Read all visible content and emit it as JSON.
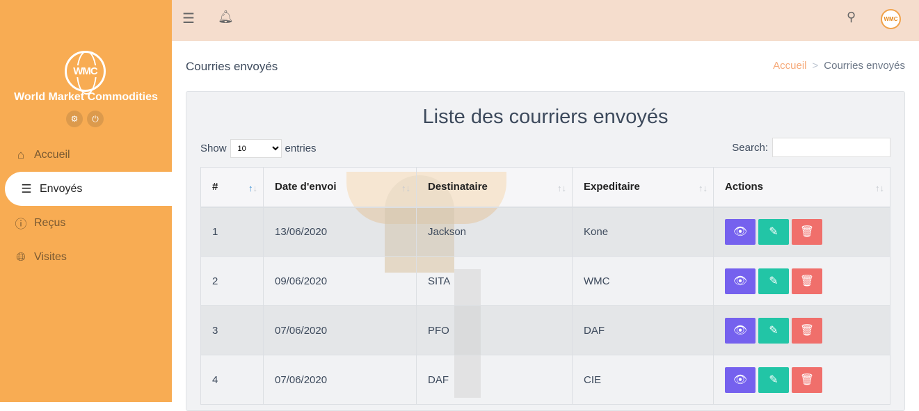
{
  "sidebar": {
    "logo_text": "WMC",
    "brand": "World Market Commodities",
    "items": [
      {
        "label": "Accueil",
        "icon": "home-icon"
      },
      {
        "label": "Envoyés",
        "icon": "list-icon"
      },
      {
        "label": "Reçus",
        "icon": "info-icon"
      },
      {
        "label": "Visites",
        "icon": "globe-icon"
      }
    ]
  },
  "topbar": {
    "avatar_text": "WMC"
  },
  "page": {
    "title": "Courries envoyés",
    "breadcrumb": [
      "Accueil",
      "Courries envoyés"
    ]
  },
  "card": {
    "title": "Liste des courriers envoyés",
    "show_label": "Show",
    "entries_label": "entries",
    "page_size": "10",
    "search_label": "Search:",
    "search_value": ""
  },
  "table": {
    "columns": [
      "#",
      "Date d'envoi",
      "Destinataire",
      "Expeditaire",
      "Actions"
    ],
    "rows": [
      [
        "1",
        "13/06/2020",
        "Jackson",
        "Kone"
      ],
      [
        "2",
        "09/06/2020",
        "SITA",
        "WMC"
      ],
      [
        "3",
        "07/06/2020",
        "PFO",
        "DAF"
      ],
      [
        "4",
        "07/06/2020",
        "DAF",
        "CIE"
      ]
    ]
  },
  "colors": {
    "sidebar": "#f8ac53",
    "topbar": "#f5ddcd",
    "view": "#7561ee",
    "edit": "#22c5a6",
    "delete": "#f06f6b"
  }
}
